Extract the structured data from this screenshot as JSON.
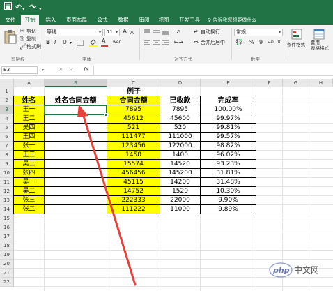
{
  "titlebar": {
    "save_icon": "save-icon",
    "undo_icon": "undo-icon",
    "redo_icon": "redo-icon",
    "customize_icon": "customize-qat-icon"
  },
  "tabs": [
    {
      "label": "文件"
    },
    {
      "label": "开始"
    },
    {
      "label": "插入"
    },
    {
      "label": "页面布局"
    },
    {
      "label": "公式"
    },
    {
      "label": "数据"
    },
    {
      "label": "审阅"
    },
    {
      "label": "视图"
    },
    {
      "label": "开发工具"
    }
  ],
  "tell_me": "♀ 告诉我您想要做什么",
  "ribbon": {
    "clipboard": {
      "cut": "剪切",
      "copy": "复制",
      "format_painter": "格式刷",
      "paste_icon": "paste-icon",
      "group": "剪贴板"
    },
    "font": {
      "name": "等线",
      "size": "11",
      "bold": "B",
      "italic": "I",
      "underline": "U",
      "grow": "A",
      "shrink": "A",
      "color_letter": "A",
      "phonetic": "wén",
      "group": "字体"
    },
    "alignment": {
      "wrap": "自动换行",
      "merge": "合并后居中",
      "group": "对齐方式"
    },
    "number": {
      "format": "常规",
      "percent": "%",
      "comma": "9",
      "group": "数字"
    },
    "styles": {
      "conditional": "条件格式",
      "table_format": "套用\n表格格式"
    }
  },
  "formula_bar": {
    "name_box": "B3",
    "fx": "fx",
    "value": ""
  },
  "columns": [
    "A",
    "B",
    "C",
    "D",
    "E",
    "F",
    "G",
    "H"
  ],
  "rows": [
    "1",
    "2",
    "3",
    "4",
    "5",
    "6",
    "7",
    "8",
    "9",
    "10",
    "11",
    "12",
    "13",
    "14",
    "15",
    "16",
    "17",
    "18",
    "19",
    "20",
    "21",
    "22"
  ],
  "sheet": {
    "title": "例子",
    "headers": [
      "姓名",
      "姓名合同金额",
      "合同金额",
      "已收款",
      "完成率"
    ],
    "data": [
      [
        "王一",
        "",
        "7895",
        "7895",
        "100.00%"
      ],
      [
        "王二",
        "",
        "45612",
        "45600",
        "99.97%"
      ],
      [
        "吴四",
        "",
        "521",
        "520",
        "99.81%"
      ],
      [
        "王四",
        "",
        "111477",
        "111000",
        "99.57%"
      ],
      [
        "张一",
        "",
        "123456",
        "122000",
        "98.82%"
      ],
      [
        "王三",
        "",
        "1458",
        "1400",
        "96.02%"
      ],
      [
        "吴三",
        "",
        "15574",
        "14520",
        "93.23%"
      ],
      [
        "张四",
        "",
        "456456",
        "145200",
        "31.81%"
      ],
      [
        "吴一",
        "",
        "45115",
        "14200",
        "31.48%"
      ],
      [
        "吴二",
        "",
        "14752",
        "1520",
        "10.30%"
      ],
      [
        "张三",
        "",
        "222333",
        "22000",
        "9.90%"
      ],
      [
        "张二",
        "",
        "111222",
        "11000",
        "9.89%"
      ]
    ]
  },
  "colors": {
    "excel_green": "#217346",
    "highlight_yellow": "#ffff00",
    "arrow_red": "#e8413a"
  },
  "watermark": {
    "text": "中文网",
    "logo_text": "php"
  }
}
